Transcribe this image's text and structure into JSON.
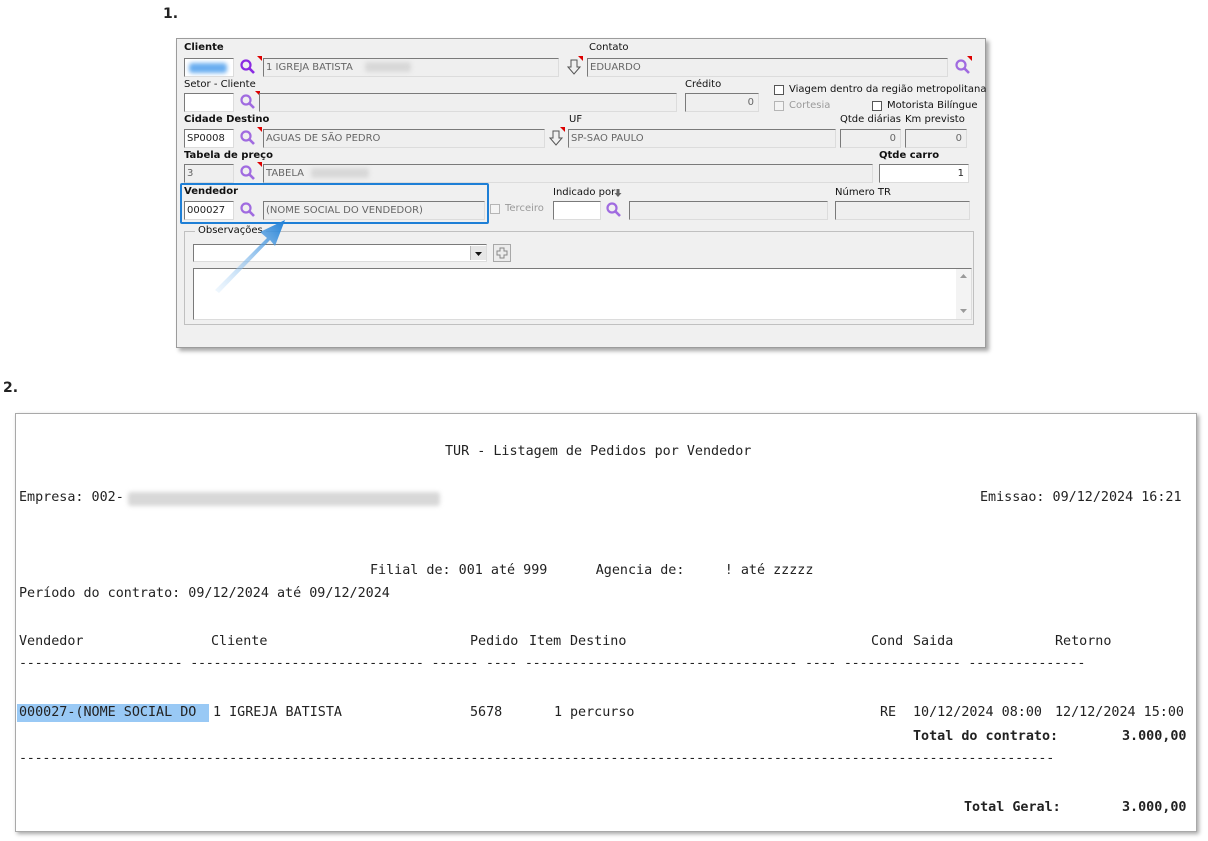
{
  "steps": {
    "one": "1.",
    "two": "2."
  },
  "form": {
    "cliente_label": "Cliente",
    "cliente_name": "1 IGREJA BATISTA",
    "contato_label": "Contato",
    "contato_value": "EDUARDO",
    "setor_label": "Setor - Cliente",
    "credito_label": "Crédito",
    "credito_value": "0",
    "viagem_label": "Viagem dentro da região metropolitana",
    "cortesia_label": "Cortesia",
    "motorista_label": "Motorista Bilíngue",
    "cidade_label": "Cidade Destino",
    "cidade_code": "SP0008",
    "cidade_name": "AGUAS DE SÃO PEDRO",
    "uf_label": "UF",
    "uf_value": "SP-SAO PAULO",
    "qtde_diarias_label": "Qtde diárias",
    "qtde_diarias_value": "0",
    "km_label": "Km previsto",
    "km_value": "0",
    "tabela_label": "Tabela de preço",
    "tabela_code": "3",
    "tabela_name": "TABELA",
    "qtde_carro_label": "Qtde carro",
    "qtde_carro_value": "1",
    "vendedor_label": "Vendedor",
    "vendedor_code": "000027",
    "vendedor_name": "(NOME SOCIAL DO VENDEDOR)",
    "terceiro_label": "Terceiro",
    "indicado_label": "Indicado por",
    "numero_tr_label": "Número TR",
    "observacoes_label": "Observações"
  },
  "report": {
    "title": "TUR - Listagem de Pedidos por Vendedor",
    "empresa_prefix": "Empresa: 002-",
    "emissao": "Emissao: 09/12/2024 16:21",
    "filtros": "Filial de: 001 até 999      Agencia de:     ! até zzzzz",
    "periodo": "Período do contrato: 09/12/2024 até 09/12/2024",
    "headers": {
      "vendedor": "Vendedor",
      "cliente": "Cliente",
      "pedido": "Pedido",
      "item": "Item",
      "destino": "Destino",
      "cond": "Cond",
      "saida": "Saida",
      "retorno": "Retorno"
    },
    "dashes": "--------------------- ------------------------------ ------ ---- ----------------------------------- ---- --------------- ---------------",
    "row": {
      "vendedor": "000027-(NOME SOCIAL DO",
      "cliente": "1 IGREJA BATISTA",
      "pedido": "5678",
      "item": "1",
      "destino": "percurso",
      "cond": "RE",
      "saida": "10/12/2024 08:00",
      "retorno": "12/12/2024 15:00"
    },
    "total_contrato_label": "Total do contrato:",
    "total_contrato_value": "3.000,00",
    "separator": "-------------------------------------------------------------------------------------------------------------------------------------",
    "total_geral_label": "Total Geral:",
    "total_geral_value": "3.000,00"
  },
  "colors": {
    "highlight": "#1e7fd6",
    "selection": "#99c9f5",
    "lookup_icon": "#8a2be2"
  },
  "icons": {
    "lookup": "magnifier-icon",
    "arrow": "down-arrow-icon",
    "plus": "plus-icon"
  }
}
